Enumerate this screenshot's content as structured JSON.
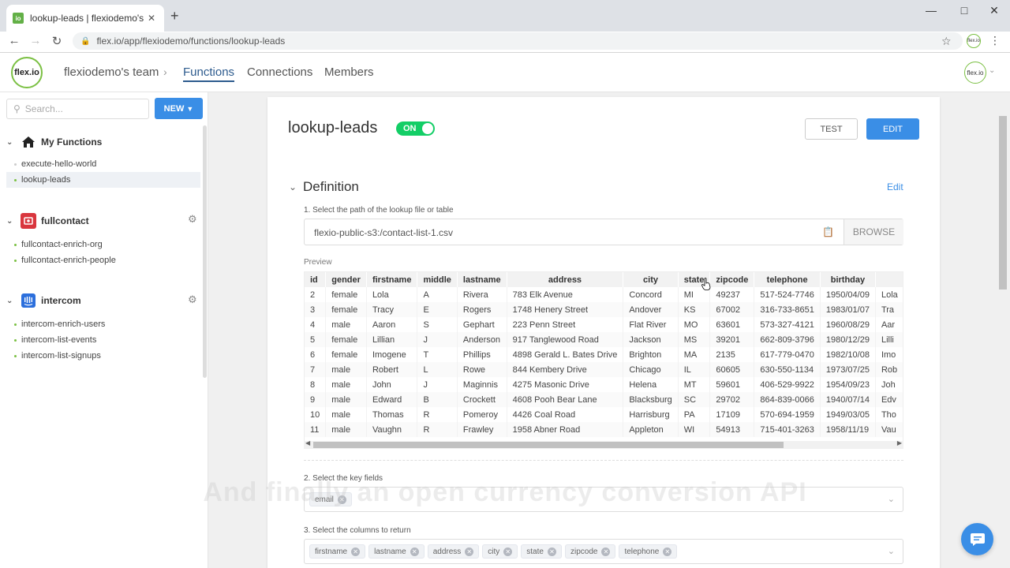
{
  "browser": {
    "tab_title": "lookup-leads | flexiodemo's team",
    "tab_favicon": "io",
    "tab_close": "✕",
    "new_tab": "+",
    "url": "flex.io/app/flexiodemo/functions/lookup-leads",
    "profile_label": "flex.io"
  },
  "header": {
    "logo": "flex.io",
    "team": "flexiodemo's team",
    "nav": {
      "functions": "Functions",
      "connections": "Connections",
      "members": "Members"
    },
    "avatar": "flex.io"
  },
  "sidebar": {
    "search_placeholder": "Search...",
    "new_button": "NEW",
    "groups": [
      {
        "label": "My Functions",
        "icon": "home-icon",
        "items": [
          "execute-hello-world",
          "lookup-leads"
        ]
      },
      {
        "label": "fullcontact",
        "icon": "fullcontact-icon",
        "items": [
          "fullcontact-enrich-org",
          "fullcontact-enrich-people"
        ]
      },
      {
        "label": "intercom",
        "icon": "intercom-icon",
        "items": [
          "intercom-enrich-users",
          "intercom-list-events",
          "intercom-list-signups"
        ]
      }
    ]
  },
  "main": {
    "title": "lookup-leads",
    "toggle": "ON",
    "test_button": "TEST",
    "edit_button": "EDIT",
    "definition_title": "Definition",
    "definition_edit": "Edit",
    "step1": "1. Select the path of the lookup file or table",
    "path_value": "flexio-public-s3:/contact-list-1.csv",
    "browse": "BROWSE",
    "preview_label": "Preview",
    "step2": "2. Select the key fields",
    "key_fields": [
      "email"
    ],
    "step3": "3. Select the columns to return",
    "return_columns": [
      "firstname",
      "lastname",
      "address",
      "city",
      "state",
      "zipcode",
      "telephone"
    ]
  },
  "table": {
    "columns": [
      "id",
      "gender",
      "firstname",
      "middle",
      "lastname",
      "address",
      "city",
      "state",
      "zipcode",
      "telephone",
      "birthday",
      ""
    ],
    "rows": [
      [
        "2",
        "female",
        "Lola",
        "A",
        "Rivera",
        "783 Elk Avenue",
        "Concord",
        "MI",
        "49237",
        "517-524-7746",
        "1950/04/09",
        "Lola"
      ],
      [
        "3",
        "female",
        "Tracy",
        "E",
        "Rogers",
        "1748 Henery Street",
        "Andover",
        "KS",
        "67002",
        "316-733-8651",
        "1983/01/07",
        "Tra"
      ],
      [
        "4",
        "male",
        "Aaron",
        "S",
        "Gephart",
        "223 Penn Street",
        "Flat River",
        "MO",
        "63601",
        "573-327-4121",
        "1960/08/29",
        "Aar"
      ],
      [
        "5",
        "female",
        "Lillian",
        "J",
        "Anderson",
        "917 Tanglewood Road",
        "Jackson",
        "MS",
        "39201",
        "662-809-3796",
        "1980/12/29",
        "Lilli"
      ],
      [
        "6",
        "female",
        "Imogene",
        "T",
        "Phillips",
        "4898 Gerald L. Bates Drive",
        "Brighton",
        "MA",
        "2135",
        "617-779-0470",
        "1982/10/08",
        "Imo"
      ],
      [
        "7",
        "male",
        "Robert",
        "L",
        "Rowe",
        "844 Kembery Drive",
        "Chicago",
        "IL",
        "60605",
        "630-550-1134",
        "1973/07/25",
        "Rob"
      ],
      [
        "8",
        "male",
        "John",
        "J",
        "Maginnis",
        "4275 Masonic Drive",
        "Helena",
        "MT",
        "59601",
        "406-529-9922",
        "1954/09/23",
        "Joh"
      ],
      [
        "9",
        "male",
        "Edward",
        "B",
        "Crockett",
        "4608 Pooh Bear Lane",
        "Blacksburg",
        "SC",
        "29702",
        "864-839-0066",
        "1940/07/14",
        "Edv"
      ],
      [
        "10",
        "male",
        "Thomas",
        "R",
        "Pomeroy",
        "4426 Coal Road",
        "Harrisburg",
        "PA",
        "17109",
        "570-694-1959",
        "1949/03/05",
        "Tho"
      ],
      [
        "11",
        "male",
        "Vaughn",
        "R",
        "Frawley",
        "1958 Abner Road",
        "Appleton",
        "WI",
        "54913",
        "715-401-3263",
        "1958/11/19",
        "Vau"
      ]
    ]
  },
  "caption": "And finally an open currency conversion API",
  "colors": {
    "accent": "#3a8ee6",
    "brand_green": "#7bc043",
    "toggle_on": "#13ce66"
  }
}
